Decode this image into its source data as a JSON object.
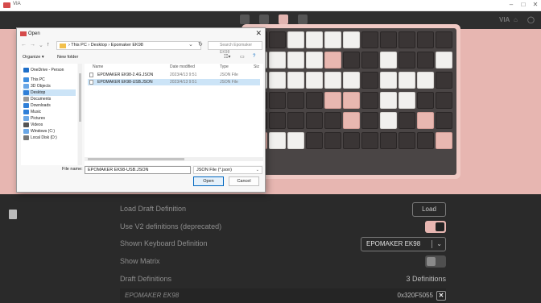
{
  "window": {
    "title": "VIA",
    "minimize": "–",
    "maximize": "□",
    "close": "✕",
    "nav_right": [
      "VIA",
      "⌂",
      "◯"
    ]
  },
  "config": {
    "rows": [
      {
        "label": "Load Draft Definition",
        "control": "button",
        "value": "Load"
      },
      {
        "label": "Use V2 definitions (deprecated)",
        "control": "toggle-on"
      },
      {
        "label": "Shown Keyboard Definition",
        "control": "select",
        "value": "EPOMAKER EK98"
      },
      {
        "label": "Show Matrix",
        "control": "toggle-off"
      },
      {
        "label": "Draft Definitions",
        "control": "text",
        "value": "3 Definitions"
      }
    ],
    "draft": {
      "name": "EPOMAKER EK98",
      "id": "0x320F5055",
      "remove": "✕"
    }
  },
  "dialog": {
    "title": "Open",
    "close": "✕",
    "path": "› This PC › Desktop › Epomaker EK98",
    "search_placeholder": "Search Epomaker EK98",
    "organize": "Organize ▾",
    "new_folder": "New folder",
    "nav_items": [
      {
        "label": "OneDrive - Person",
        "color": "#1f6fc9"
      },
      {
        "label": "This PC",
        "color": "#3d8ee0"
      },
      {
        "label": "3D Objects",
        "color": "#6aa7e6"
      },
      {
        "label": "Desktop",
        "color": "#2f7fd8"
      },
      {
        "label": "Documents",
        "color": "#9a9a9a"
      },
      {
        "label": "Downloads",
        "color": "#2f7fd8"
      },
      {
        "label": "Music",
        "color": "#2f7fd8"
      },
      {
        "label": "Pictures",
        "color": "#6aa7e6"
      },
      {
        "label": "Videos",
        "color": "#555555"
      },
      {
        "label": "Windows (C:)",
        "color": "#6aa7e6"
      },
      {
        "label": "Local Disk (D:)",
        "color": "#777777"
      }
    ],
    "headers": {
      "name": "Name",
      "date": "Date modified",
      "type": "Type",
      "size": "Siz"
    },
    "files": [
      {
        "name": "EPOMAKER EK98-2.4G.JSON",
        "date": "2023/4/13 9:51",
        "type": "JSON File"
      },
      {
        "name": "EPOMAKER EK98-USB.JSON",
        "date": "2023/4/13 9:51",
        "type": "JSON File"
      }
    ],
    "filename_label": "File name:",
    "filename_value": "EPOMAKER EK98-USB.JSON",
    "filetype": "JSON File (*.json)",
    "open_label": "Open",
    "cancel_label": "Cancel"
  },
  "keyboard": {
    "colors": {
      "white": "#f1f0ee",
      "pink": "#e8b7b0",
      "dark": "#3a3535",
      "background": "#e7b6b1"
    }
  }
}
